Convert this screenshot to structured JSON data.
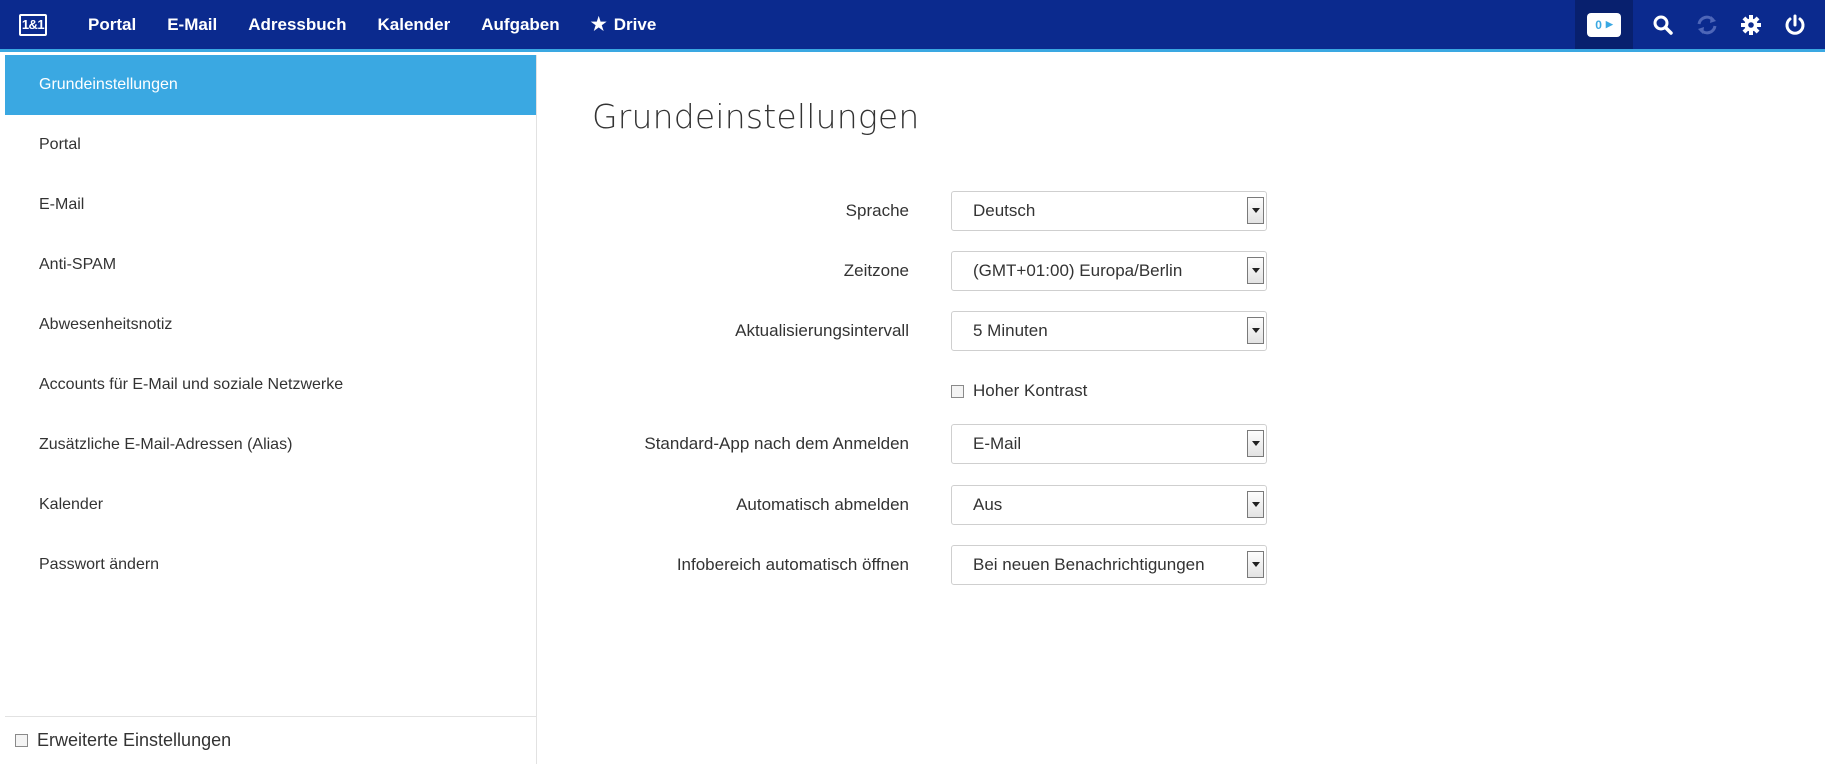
{
  "header": {
    "logo": "1&1",
    "nav": [
      "Portal",
      "E-Mail",
      "Adressbuch",
      "Kalender",
      "Aufgaben",
      "Drive"
    ],
    "notification_count": "0",
    "icons": [
      "search-icon",
      "refresh-icon",
      "gear-icon",
      "power-icon"
    ],
    "colors": {
      "bar": "#0b2a8e",
      "accent": "#3aa8e2"
    }
  },
  "sidebar": {
    "items": [
      {
        "label": "Grundeinstellungen",
        "active": true
      },
      {
        "label": "Portal"
      },
      {
        "label": "E-Mail"
      },
      {
        "label": "Anti-SPAM"
      },
      {
        "label": "Abwesenheitsnotiz"
      },
      {
        "label": "Accounts für E-Mail und soziale Netzwerke"
      },
      {
        "label": "Zusätzliche E-Mail-Adressen (Alias)"
      },
      {
        "label": "Kalender"
      },
      {
        "label": "Passwort ändern"
      }
    ],
    "footer_checkbox_label": "Erweiterte Einstellungen"
  },
  "main": {
    "title": "Grundeinstellungen",
    "fields": [
      {
        "label": "Sprache",
        "value": "Deutsch"
      },
      {
        "label": "Zeitzone",
        "value": "(GMT+01:00) Europa/Berlin"
      },
      {
        "label": "Aktualisierungsintervall",
        "value": "5 Minuten"
      },
      {
        "label": "Standard-App nach dem Anmelden",
        "value": "E-Mail"
      },
      {
        "label": "Automatisch abmelden",
        "value": "Aus"
      },
      {
        "label": "Infobereich automatisch öffnen",
        "value": "Bei neuen Benachrichtigungen"
      }
    ],
    "high_contrast_label": "Hoher Kontrast"
  }
}
